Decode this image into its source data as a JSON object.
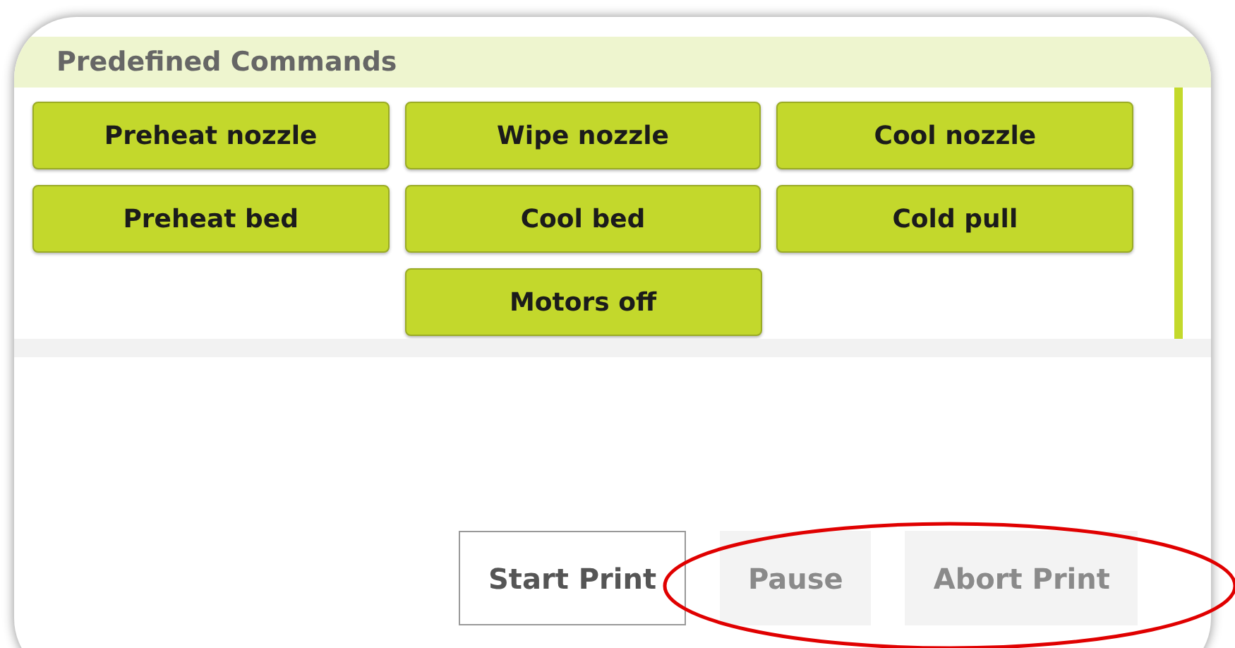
{
  "panel": {
    "title": "Predefined Commands"
  },
  "command_rows": [
    [
      "Preheat nozzle",
      "Wipe nozzle",
      "Cool nozzle"
    ],
    [
      "Preheat bed",
      "Cool bed",
      "Cold pull"
    ],
    [
      "Motors off"
    ]
  ],
  "print_buttons": [
    {
      "label": "Start Print",
      "disabled": false
    },
    {
      "label": "Pause",
      "disabled": true
    },
    {
      "label": "Abort Print",
      "disabled": true
    }
  ]
}
